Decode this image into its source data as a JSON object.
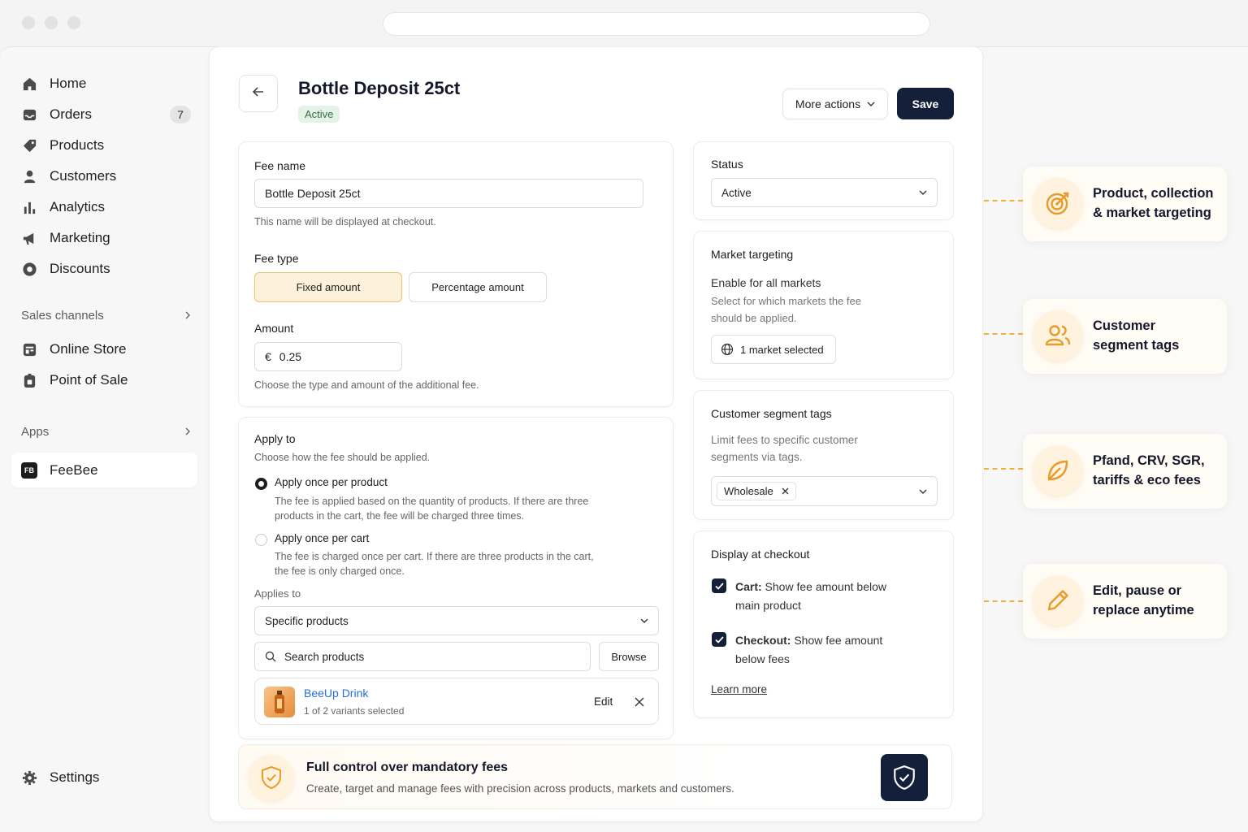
{
  "sidebar": {
    "nav": [
      {
        "label": "Home",
        "icon": "home-icon"
      },
      {
        "label": "Orders",
        "icon": "inbox-icon",
        "badge": "7"
      },
      {
        "label": "Products",
        "icon": "tag-icon"
      },
      {
        "label": "Customers",
        "icon": "person-icon"
      },
      {
        "label": "Analytics",
        "icon": "bar-chart-icon"
      },
      {
        "label": "Marketing",
        "icon": "megaphone-icon"
      },
      {
        "label": "Discounts",
        "icon": "discount-icon"
      }
    ],
    "sales_channels_label": "Sales channels",
    "channels": [
      {
        "label": "Online Store",
        "icon": "store-icon"
      },
      {
        "label": "Point of Sale",
        "icon": "pos-icon"
      }
    ],
    "apps_label": "Apps",
    "app": {
      "label": "FeeBee",
      "logo": "FB"
    },
    "settings_label": "Settings"
  },
  "header": {
    "title": "Bottle Deposit 25ct",
    "status_pill": "Active",
    "more_actions": "More actions",
    "save": "Save"
  },
  "fee": {
    "name_label": "Fee name",
    "name_value": "Bottle Deposit 25ct",
    "name_help": "This name will be displayed at checkout.",
    "type_label": "Fee type",
    "type_fixed": "Fixed amount",
    "type_percent": "Percentage amount",
    "amount_label": "Amount",
    "currency": "€",
    "amount_value": "0.25",
    "amount_help": "Choose the type and amount of the additional fee."
  },
  "apply": {
    "title": "Apply to",
    "subtitle": "Choose how the fee should be applied.",
    "opt1_label": "Apply once per product",
    "opt1_desc_1": "The fee is applied based on the quantity of products. If there are three",
    "opt1_desc_2": "products in the cart, the fee will be charged three times.",
    "opt2_label": "Apply once per cart",
    "opt2_desc_1": "The fee is charged once per cart. If there are three products in the cart,",
    "opt2_desc_2": "the fee is only charged once.",
    "applies_to_label": "Applies to",
    "applies_to_value": "Specific products",
    "search_placeholder": "Search products",
    "browse": "Browse",
    "product_name": "BeeUp Drink",
    "product_variants": "1 of 2 variants selected",
    "product_edit": "Edit"
  },
  "status_card": {
    "label": "Status",
    "value": "Active"
  },
  "market_card": {
    "title": "Market targeting",
    "enable_label": "Enable for all markets",
    "help_1": "Select for which markets the fee",
    "help_2": "should be applied.",
    "button": "1 market selected"
  },
  "segment_card": {
    "title": "Customer segment tags",
    "help_1": "Limit fees to specific customer",
    "help_2": "segments via tags.",
    "tag": "Wholesale"
  },
  "display_card": {
    "title": "Display at checkout",
    "cart_bold": "Cart:",
    "cart_text_1": " Show fee amount below",
    "cart_text_2": "main product",
    "checkout_bold": "Checkout:",
    "checkout_text_1": " Show fee amount",
    "checkout_text_2": "below fees",
    "learn_more": "Learn more"
  },
  "banner": {
    "title": "Full control over mandatory fees",
    "subtitle": "Create, target and manage fees with precision across products, markets and customers."
  },
  "features": [
    {
      "line1": "Product, collection",
      "line2": "& market targeting",
      "icon": "target-icon"
    },
    {
      "line1": "Customer",
      "line2": "segment tags",
      "icon": "users-icon"
    },
    {
      "line1": "Pfand, CRV, SGR,",
      "line2": "tariffs & eco fees",
      "icon": "leaf-icon"
    },
    {
      "line1": "Edit, pause or",
      "line2": "replace anytime",
      "icon": "pencil-icon"
    }
  ],
  "colors": {
    "primary": "#14203a",
    "accent": "#e89a2a",
    "link": "#2a6fd6",
    "active_green_bg": "#e4f3e8"
  }
}
